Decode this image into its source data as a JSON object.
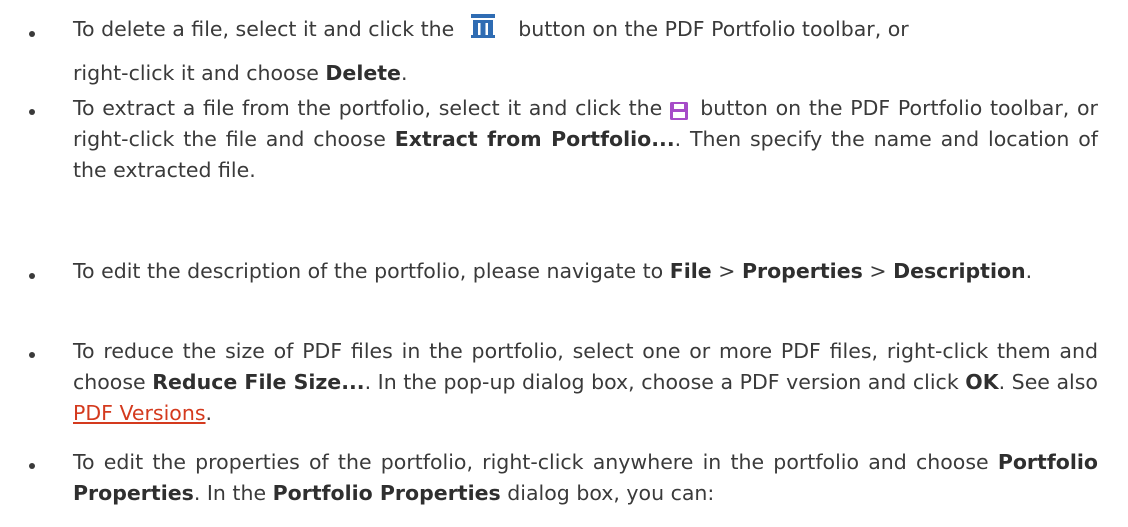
{
  "items": [
    {
      "line1_pre": "To delete a file, select it and click the",
      "line1_post": "button on the PDF Portfolio toolbar, or",
      "line2_pre": "right-click it and choose",
      "bold1": "Delete",
      "line2_post": ".",
      "icon": "trash-icon"
    },
    {
      "pre": "To extract a file from the portfolio, select it and click the",
      "mid": "button on the PDF Portfolio toolbar, or right-click the file and choose",
      "bold1": "Extract from Portfolio...",
      "post": ". Then specify the name and location of the extracted file.",
      "icon": "save-icon"
    },
    {
      "pre": "To edit the description of the portfolio, please navigate to",
      "bold1": "File",
      "sep1": ">",
      "bold2": "Properties",
      "sep2": ">",
      "bold3": "Description",
      "post": "."
    },
    {
      "pre": "To reduce the size of PDF files in the portfolio, select one or more PDF files, right-click them and choose",
      "bold1": "Reduce File Size...",
      "mid": ". In the pop-up dialog box, choose a PDF version and click",
      "bold2": "OK",
      "mid2": ". See also",
      "link": "PDF Versions",
      "post": "."
    },
    {
      "pre": "To edit the properties of the portfolio, right-click anywhere in the portfolio and choose",
      "bold1": "Portfolio Properties",
      "mid": ". In the",
      "bold2": "Portfolio Properties",
      "post": "dialog box, you can:"
    }
  ],
  "colors": {
    "text": "#3a3a3a",
    "link": "#d43a1e",
    "trash_icon": "#2f6cb3",
    "save_icon": "#a64cc8"
  }
}
